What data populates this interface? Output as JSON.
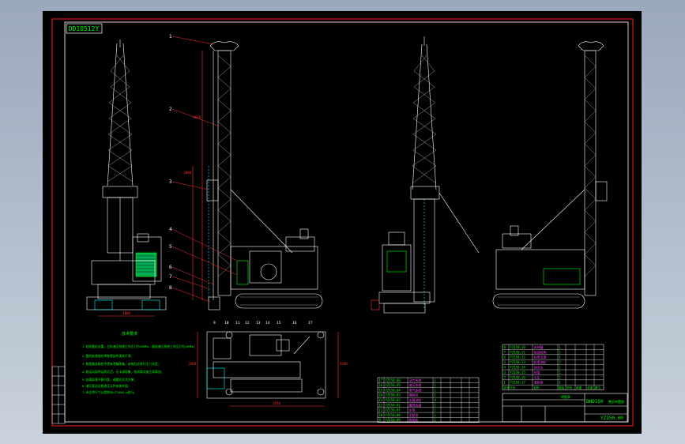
{
  "drawing": {
    "frame_code": "DD10512Y",
    "drawing_number": "YZ150.00",
    "part_title": "BHD150",
    "part_subtitle": "整机布置图",
    "table_header_label": "明细表",
    "callouts": [
      "1",
      "2",
      "3",
      "4",
      "5",
      "6",
      "7",
      "8",
      "9",
      "10",
      "11",
      "12",
      "13",
      "14",
      "15",
      "16",
      "17"
    ],
    "dims": [
      "1800",
      "9600",
      "2800",
      "2600",
      "3440",
      "2650",
      "1800"
    ],
    "notes_title": "技术要求",
    "notes": [
      "1.钻机整机总重，主机液压系统工作压力为35MPa，副机液压系统工作压力为15MPa；",
      "2.整机安装前应将各零部件清洗干净；",
      "3.各管路连接处不得有泄漏现象，安装后应进行压力试验；",
      "4.各运动部件运转灵活，无卡滞现象，各润滑点加注润滑油；",
      "5.钻塔起落平稳可靠，调整应灵活方便；",
      "6.液压泵站及各液压元件安装牢固；",
      "7.未注明尺寸公差按GB/T1804-m执行。"
    ]
  },
  "bom_left": [
    {
      "no": "17",
      "code": "YZ150.06",
      "name": "动力系统",
      "qty": "1",
      "mat": "",
      "wt": ""
    },
    {
      "no": "16",
      "code": "YZ150.05",
      "name": "液压系统",
      "qty": "1",
      "mat": "",
      "wt": ""
    },
    {
      "no": "15",
      "code": "YZ150.04",
      "name": "电气系统",
      "qty": "1",
      "mat": "",
      "wt": ""
    },
    {
      "no": "14",
      "code": "YZ150.03",
      "name": "操纵台",
      "qty": "1",
      "mat": "",
      "wt": ""
    },
    {
      "no": "13",
      "code": "YZ150.02",
      "name": "支腿油缸",
      "qty": "4",
      "mat": "",
      "wt": ""
    },
    {
      "no": "12",
      "code": "YZ150.01",
      "name": "履带底盘",
      "qty": "1",
      "mat": "",
      "wt": ""
    },
    {
      "no": "11",
      "code": "YZ150.07",
      "name": "水泵",
      "qty": "1",
      "mat": "",
      "wt": ""
    },
    {
      "no": "10",
      "code": "YZ150.08",
      "name": "泥浆泵",
      "qty": "1",
      "mat": "",
      "wt": ""
    },
    {
      "no": "9",
      "code": "YZ150.09",
      "name": "卷扬机",
      "qty": "1",
      "mat": "",
      "wt": ""
    }
  ],
  "bom_right": [
    {
      "no": "8",
      "code": "YZ150.10",
      "name": "夹持器",
      "qty": "1",
      "mat": "",
      "wt": ""
    },
    {
      "no": "7",
      "code": "YZ150.11",
      "name": "给进机构",
      "qty": "1",
      "mat": "",
      "wt": ""
    },
    {
      "no": "6",
      "code": "YZ150.12",
      "name": "钻塔支架",
      "qty": "1",
      "mat": "",
      "wt": ""
    },
    {
      "no": "5",
      "code": "YZ150.13",
      "name": "起塔油缸",
      "qty": "2",
      "mat": "",
      "wt": ""
    },
    {
      "no": "4",
      "code": "YZ150.14",
      "name": "动力头",
      "qty": "1",
      "mat": "",
      "wt": ""
    },
    {
      "no": "3",
      "code": "YZ150.15",
      "name": "钻塔",
      "qty": "1",
      "mat": "",
      "wt": ""
    },
    {
      "no": "2",
      "code": "YZ150.16",
      "name": "天车",
      "qty": "1",
      "mat": "",
      "wt": ""
    },
    {
      "no": "1",
      "code": "YZ150.17",
      "name": "滑轮组",
      "qty": "1",
      "mat": "",
      "wt": ""
    }
  ],
  "bom_right_header": [
    "序号",
    "代号",
    "名称",
    "数量",
    "材料",
    "单重",
    "总重",
    "备注"
  ],
  "colors": {
    "bg": "#000000",
    "frame": "#ff0000",
    "line": "#ffffff",
    "accent": "#00ff00",
    "dim": "#ff3030",
    "magenta": "#ff00ff",
    "cyan": "#00ffff",
    "outer": "#b7c2d0"
  }
}
